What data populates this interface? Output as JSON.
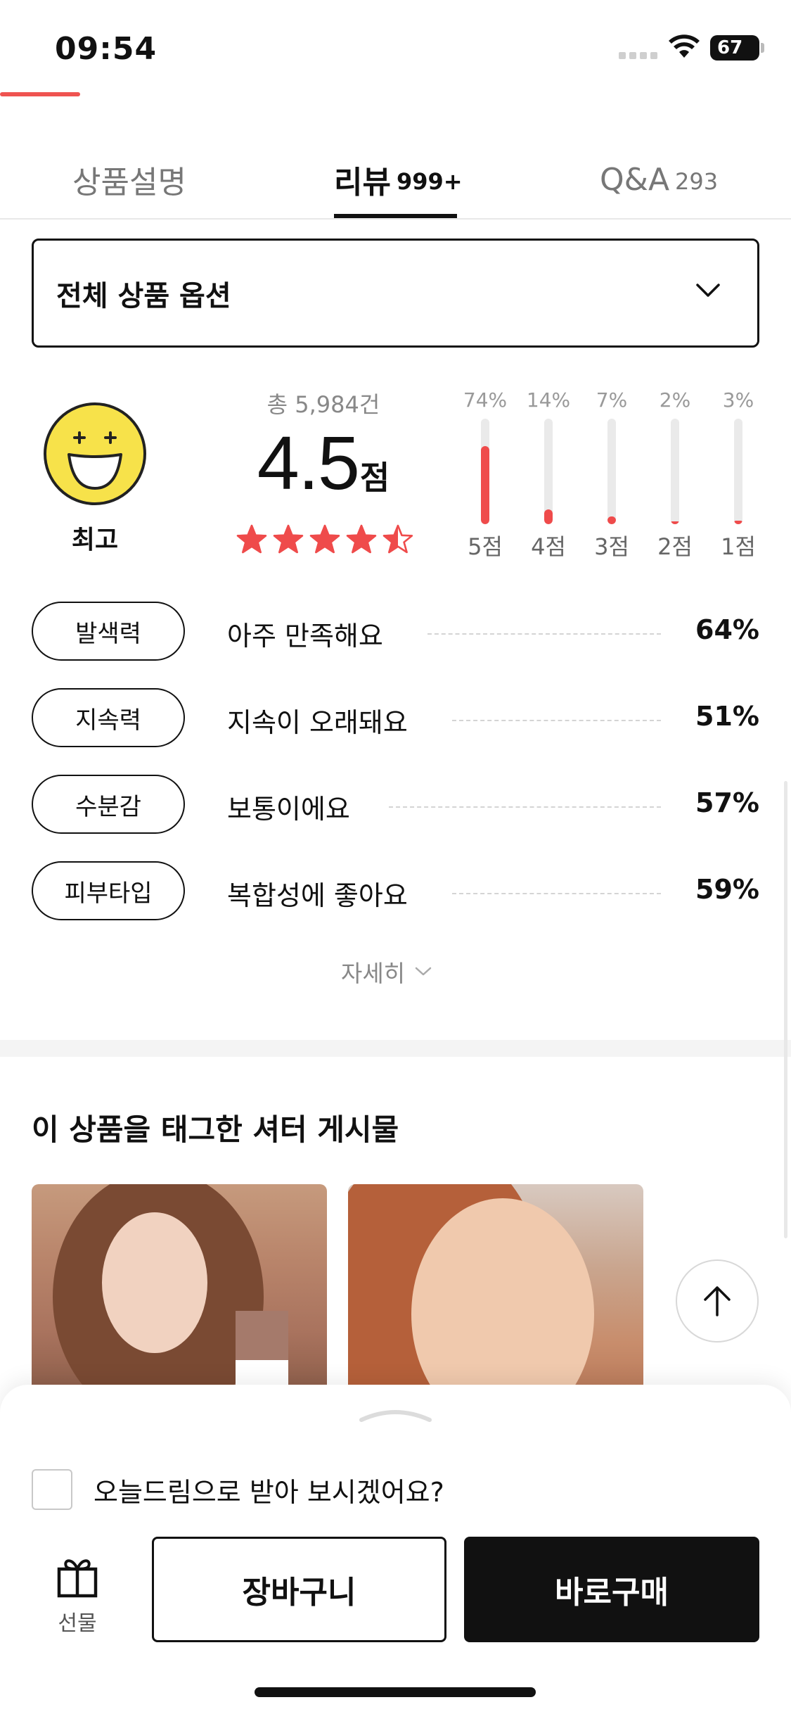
{
  "status_bar": {
    "time": "09:54",
    "battery": "67"
  },
  "tabs": [
    {
      "label": "상품설명",
      "count": ""
    },
    {
      "label": "리뷰",
      "count": "999+"
    },
    {
      "label": "Q&A",
      "count": "293"
    }
  ],
  "option_select": {
    "label": "전체 상품 옵션"
  },
  "rating": {
    "badge_label": "최고",
    "total_count": "총 5,984건",
    "score": "4.5",
    "score_unit": "점",
    "stars": 4.5,
    "distribution": [
      {
        "label": "5점",
        "percent_text": "74%",
        "percent": 74
      },
      {
        "label": "4점",
        "percent_text": "14%",
        "percent": 14
      },
      {
        "label": "3점",
        "percent_text": "7%",
        "percent": 7
      },
      {
        "label": "2점",
        "percent_text": "2%",
        "percent": 2
      },
      {
        "label": "1점",
        "percent_text": "3%",
        "percent": 3
      }
    ]
  },
  "attributes": [
    {
      "name": "발색력",
      "value": "아주 만족해요",
      "percent": "64%"
    },
    {
      "name": "지속력",
      "value": "지속이 오래돼요",
      "percent": "51%"
    },
    {
      "name": "수분감",
      "value": "보통이에요",
      "percent": "57%"
    },
    {
      "name": "피부타입",
      "value": "복합성에 좋아요",
      "percent": "59%"
    }
  ],
  "more_label": "자세히",
  "shutter_section": {
    "title": "이 상품을 태그한 셔터 게시물"
  },
  "bottom_bar": {
    "checkbox_label": "오늘드림으로 받아 보시겠어요?",
    "gift_label": "선물",
    "cart_label": "장바구니",
    "buy_label": "바로구매"
  },
  "colors": {
    "accent": "#ef4b4b",
    "primary_dark": "#111111"
  }
}
